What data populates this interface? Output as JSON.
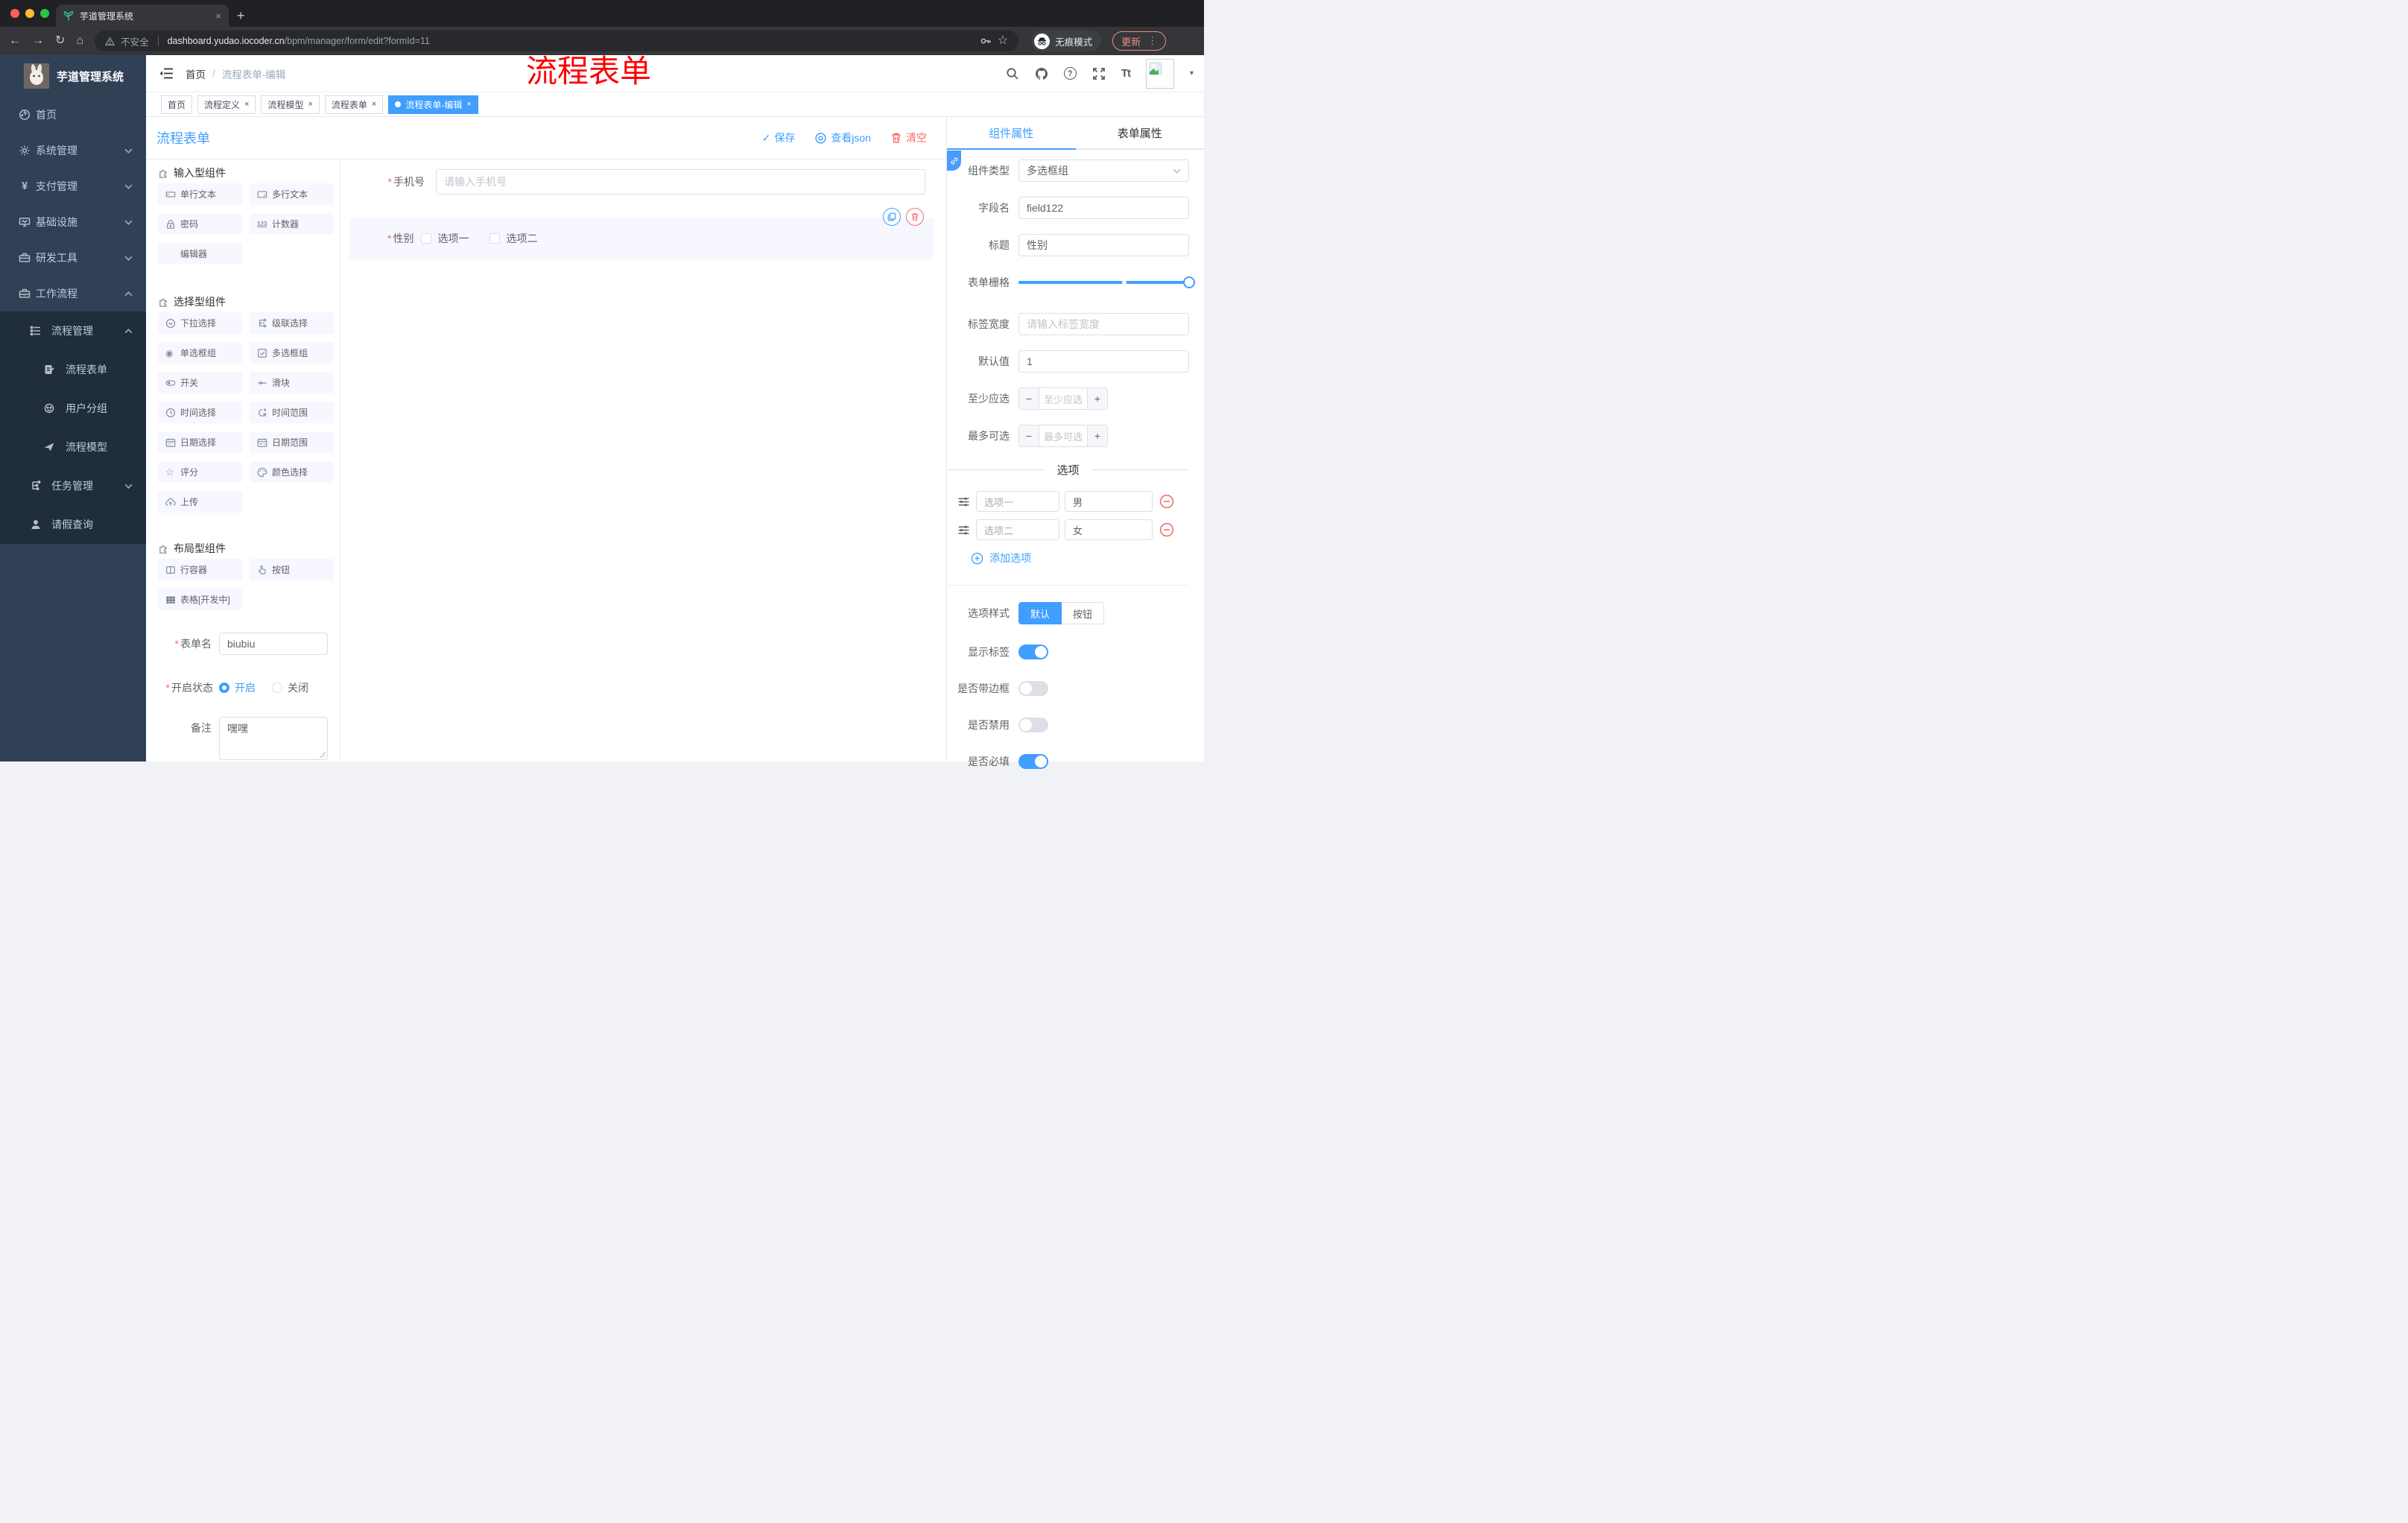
{
  "browser": {
    "tab_title": "芋道管理系统",
    "not_secure": "不安全",
    "url_host": "dashboard.yudao.iocoder.cn",
    "url_path": "/bpm/manager/form/edit?formId=11",
    "incognito_label": "无痕模式",
    "update_label": "更新"
  },
  "icons": {
    "back": "←",
    "forward": "→",
    "reload": "↻",
    "home": "⌂",
    "plus": "+",
    "close": "×",
    "caret": "▾",
    "kebab": "⋮",
    "check": "✓",
    "star": "☆",
    "question": "?",
    "radio": "◉",
    "minus": "−",
    "slash": "/",
    "tt": "Tt",
    "count": "123"
  },
  "sidebar": {
    "logo_title": "芋道管理系统",
    "items": [
      {
        "label": "首页"
      },
      {
        "label": "系统管理"
      },
      {
        "label": "支付管理"
      },
      {
        "label": "基础设施"
      },
      {
        "label": "研发工具"
      },
      {
        "label": "工作流程"
      },
      {
        "label": "流程管理"
      },
      {
        "label": "流程表单"
      },
      {
        "label": "用户分组"
      },
      {
        "label": "流程模型"
      },
      {
        "label": "任务管理"
      },
      {
        "label": "请假查询"
      }
    ]
  },
  "header": {
    "breadcrumb_home": "首页",
    "breadcrumb_current": "流程表单-编辑",
    "watermark": "流程表单"
  },
  "tags": [
    {
      "label": "首页"
    },
    {
      "label": "流程定义"
    },
    {
      "label": "流程模型"
    },
    {
      "label": "流程表单"
    },
    {
      "label": "流程表单-编辑"
    }
  ],
  "pagehead": {
    "title": "流程表单",
    "save": "保存",
    "view_json": "查看json",
    "clear": "清空"
  },
  "components": {
    "input_title": "输入型组件",
    "input_items": [
      "单行文本",
      "多行文本",
      "密码",
      "计数器",
      "编辑器"
    ],
    "select_title": "选择型组件",
    "select_items": [
      "下拉选择",
      "级联选择",
      "单选框组",
      "多选框组",
      "开关",
      "滑块",
      "时间选择",
      "时间范围",
      "日期选择",
      "日期范围",
      "评分",
      "颜色选择",
      "上传"
    ],
    "layout_title": "布局型组件",
    "layout_items": [
      "行容器",
      "按钮",
      "表格[开发中]"
    ]
  },
  "form_meta": {
    "name_label": "表单名",
    "name_value": "biubiu",
    "status_label": "开启状态",
    "status_on": "开启",
    "status_off": "关闭",
    "remark_label": "备注",
    "remark_value": "嘿嘿"
  },
  "canvas": {
    "phone_label": "手机号",
    "phone_placeholder": "请输入手机号",
    "gender_label": "性别",
    "gender_option1": "选项一",
    "gender_option2": "选项二"
  },
  "panel": {
    "tab_component": "组件属性",
    "tab_form": "表单属性",
    "rows": {
      "type_label": "组件类型",
      "type_value": "多选框组",
      "field_label": "字段名",
      "field_value": "field122",
      "title_label": "标题",
      "title_value": "性别",
      "grid_label": "表单栅格",
      "labelwidth_label": "标签宽度",
      "labelwidth_placeholder": "请输入标签宽度",
      "default_label": "默认值",
      "default_value": "1",
      "min_label": "至少应选",
      "min_placeholder": "至少应选",
      "max_label": "最多可选",
      "max_placeholder": "最多可选"
    },
    "options_title": "选项",
    "options": [
      {
        "label": "选项一",
        "value": "男"
      },
      {
        "label": "选项二",
        "value": "女"
      }
    ],
    "add_option": "添加选项",
    "style_label": "选项样式",
    "style_default": "默认",
    "style_button": "按钮",
    "toggles": [
      {
        "label": "显示标签",
        "on": true
      },
      {
        "label": "是否带边框",
        "on": false
      },
      {
        "label": "是否禁用",
        "on": false
      },
      {
        "label": "是否必填",
        "on": true
      }
    ]
  },
  "colors": {
    "accent": "#409eff",
    "danger": "#f56c6c",
    "watermark": "#fe0100",
    "sidebar": "#304156",
    "submenu": "#1f2d3d",
    "traffic_red": "#ff5f57",
    "traffic_yellow": "#febc2e",
    "traffic_green": "#28c840"
  }
}
